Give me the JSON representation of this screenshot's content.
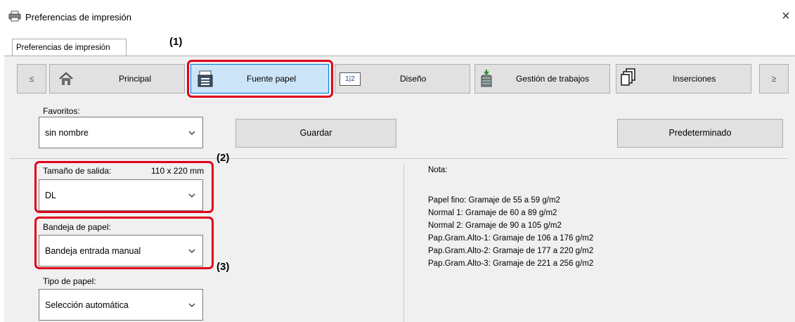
{
  "window": {
    "title": "Preferencias de impresión",
    "close_symbol": "×",
    "tab_label": "Preferencias de impresión"
  },
  "nav": {
    "prev_symbol": "≤",
    "next_symbol": "≥",
    "items": [
      {
        "label": "Principal",
        "icon": "home-icon"
      },
      {
        "label": "Fuente papel",
        "icon": "paper-tray-icon"
      },
      {
        "label": "Diseño",
        "icon": "layout-icon",
        "icon_text": "1|2"
      },
      {
        "label": "Gestión de trabajos",
        "icon": "job-stack-icon"
      },
      {
        "label": "Inserciones",
        "icon": "inserts-icon"
      }
    ],
    "selected": "Fuente papel"
  },
  "favorites": {
    "label": "Favoritos:",
    "value": "sin nombre",
    "save_label": "Guardar",
    "default_label": "Predeterminado"
  },
  "output_size": {
    "label": "Tamaño de salida:",
    "dimensions": "110 x 220 mm",
    "value": "DL"
  },
  "paper_tray": {
    "label": "Bandeja de papel:",
    "value": "Bandeja entrada manual"
  },
  "paper_type": {
    "label": "Tipo de papel:",
    "value": "Selección automática"
  },
  "note": {
    "title": "Nota:",
    "lines": [
      "Papel fino: Gramaje de 55 a 59 g/m2",
      "Normal 1: Gramaje de 60 a 89 g/m2",
      "Normal 2: Gramaje de 90 a 105 g/m2",
      "Pap.Gram.Alto-1: Gramaje de 106 a 176 g/m2",
      "Pap.Gram.Alto-2: Gramaje de 177 a 220 g/m2",
      "Pap.Gram.Alto-3: Gramaje de 221 a 256 g/m2"
    ]
  },
  "callouts": [
    "(1)",
    "(2)",
    "(3)"
  ],
  "colors": {
    "highlight": "#e0001a",
    "selected_bg": "#cce4f7",
    "selected_border": "#0078d7"
  }
}
